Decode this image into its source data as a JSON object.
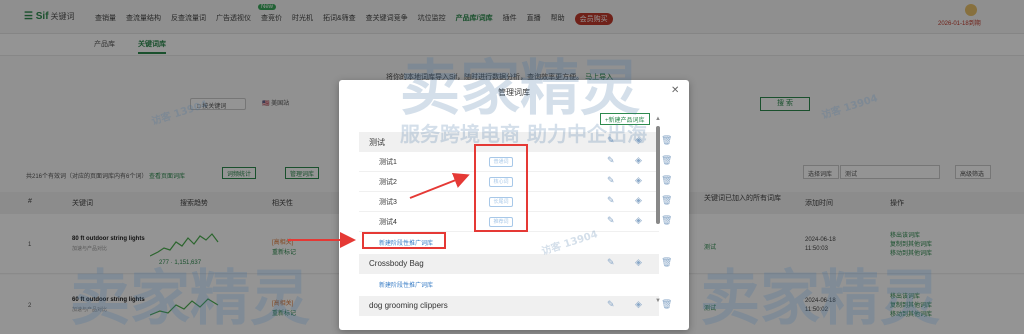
{
  "header": {
    "logo": "Sif",
    "logo_sub": "关键词",
    "nav": [
      "查销量",
      "查流量结构",
      "反查流量词",
      "广告透视仪",
      "查竞价",
      "时光机",
      "拓词&筛查",
      "查关键词竞争",
      "坑位监控",
      "产品库/词库",
      "插件",
      "直播",
      "帮助",
      "会员购买"
    ],
    "new_badge": "New",
    "date_text": "2026-01-18到期"
  },
  "subtabs": [
    "产品库",
    "关键词库"
  ],
  "page": {
    "hint_text": "将你的本地词库导入Sif，随时进行数据分析，查询效率更方便。",
    "hint_link": "马上导入",
    "filter_keyword": "□ 按关键词",
    "filter_market": "🇺🇸 美国站",
    "search_btn": "搜 索",
    "stats_text": "共216个有效词（对应的页面词库内有6个词）",
    "stats_link": "查看页面词库",
    "btn_stats": "词频统计",
    "btn_manage": "管理词库",
    "select_lib_label": "选择词库",
    "select_lib_value": "测试",
    "btn_adv": "高级筛选"
  },
  "table": {
    "headers": [
      "#",
      "关键词",
      "搜索趋势",
      "相关性",
      "关键词已加入的所有词库",
      "添加时间",
      "操作"
    ],
    "rows": [
      {
        "num": "1",
        "keyword": "80 ft outdoor string lights",
        "kw_sub": "加速与产品对比",
        "relevance": "[高相关]",
        "relevance2": "重新标记",
        "trend_a": "277",
        "trend_b": "1,151,637",
        "lib": "测试",
        "time1": "2024-06-18",
        "time2": "11:50:03",
        "ops": [
          "移出该词库",
          "复制到其他词库",
          "移动到其他词库"
        ]
      },
      {
        "num": "2",
        "keyword": "60 ft outdoor string lights",
        "kw_sub": "加速与产品对比",
        "relevance": "[高相关]",
        "relevance2": "重新标记",
        "lib": "测试",
        "time1": "2024-06-18",
        "time2": "11:50:02",
        "ops": [
          "移出该词库",
          "复制到其他词库",
          "移动到其他词库"
        ]
      }
    ]
  },
  "modal": {
    "title": "管理词库",
    "new_lib_btn": "+新建产品词库",
    "groups": [
      {
        "name": "测试",
        "children": [
          {
            "name": "测试1",
            "status": "普通词"
          },
          {
            "name": "测试2",
            "status": "核心词"
          },
          {
            "name": "测试3",
            "status": "长尾词"
          },
          {
            "name": "测试4",
            "status": "推荐词"
          }
        ],
        "add_link": "新建阶段性推广词库"
      },
      {
        "name": "Crossbody Bag",
        "children": [],
        "add_link": "新建阶段性推广词库"
      },
      {
        "name": "dog grooming clippers",
        "children": []
      }
    ]
  },
  "watermark": {
    "brand": "卖家精灵",
    "slogan": "服务跨境电商 助力中企出海",
    "id_text": "访客 13904"
  },
  "colors": {
    "brand": "#2d8a4e",
    "highlight": "#e53935",
    "link": "#3a7ec6"
  }
}
